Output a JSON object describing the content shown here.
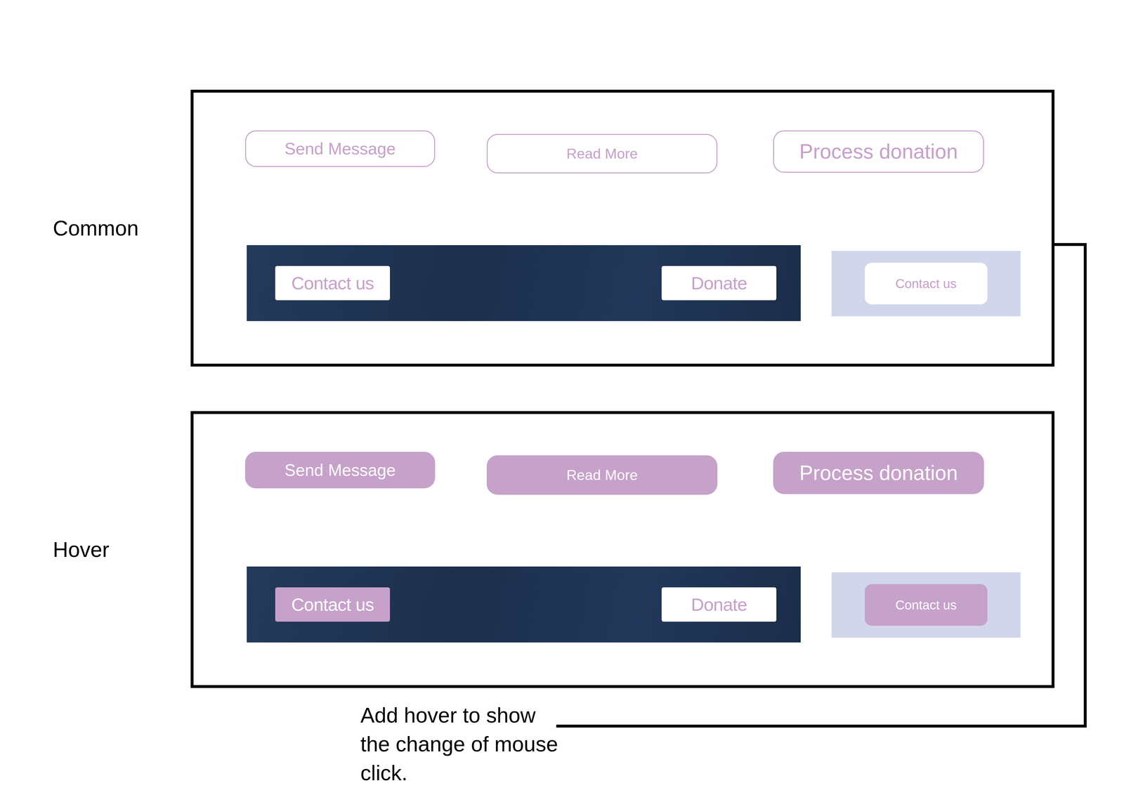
{
  "sections": [
    {
      "label": "Common",
      "outline_buttons": [
        {
          "label": "Send Message",
          "hovered": false
        },
        {
          "label": "Read More",
          "hovered": false
        },
        {
          "label": "Process donation",
          "hovered": false
        }
      ],
      "banner": {
        "buttons": [
          {
            "label": "Contact us",
            "hovered": false
          },
          {
            "label": "Donate",
            "hovered": false
          }
        ]
      },
      "panel": {
        "button": {
          "label": "Contact us",
          "hovered": false
        }
      }
    },
    {
      "label": "Hover",
      "outline_buttons": [
        {
          "label": "Send Message",
          "hovered": true
        },
        {
          "label": "Read More",
          "hovered": true
        },
        {
          "label": "Process donation",
          "hovered": true
        }
      ],
      "banner": {
        "buttons": [
          {
            "label": "Contact us",
            "hovered": true
          },
          {
            "label": "Donate",
            "hovered": false
          }
        ]
      },
      "panel": {
        "button": {
          "label": "Contact us",
          "hovered": true
        }
      }
    }
  ],
  "annotation": {
    "lines": [
      "Add hover to show",
      "the change of mouse",
      "click."
    ]
  }
}
